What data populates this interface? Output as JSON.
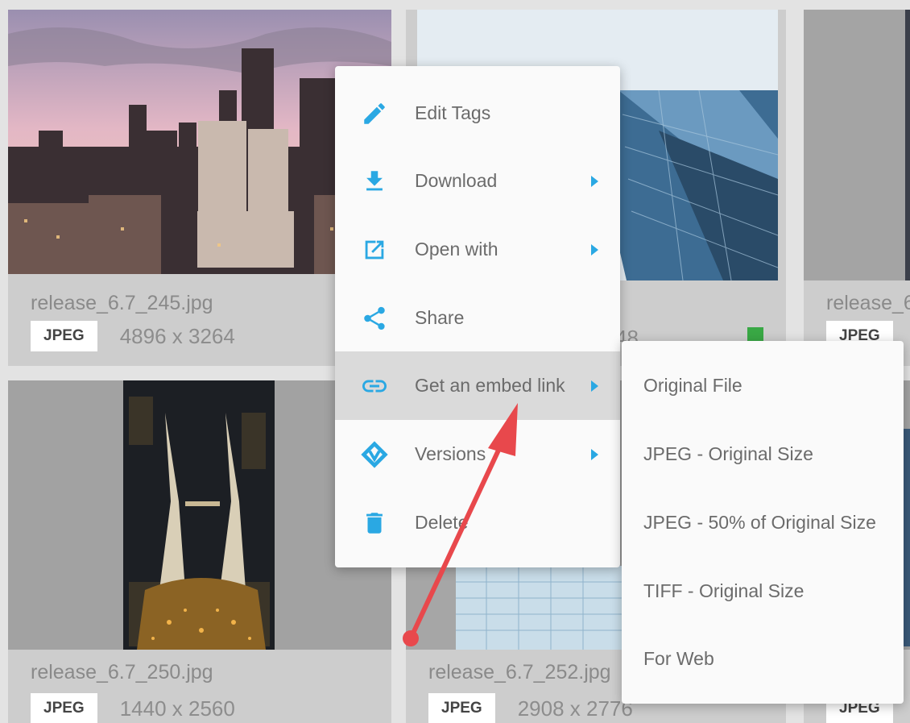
{
  "cards": [
    {
      "name": "release_6.7_245.jpg",
      "format": "JPEG",
      "dims": "4896 x 3264"
    },
    {
      "name": "",
      "format": "",
      "dims": "48"
    },
    {
      "name": "release_6",
      "format": "JPEG",
      "dims": ""
    },
    {
      "name": "release_6.7_250.jpg",
      "format": "JPEG",
      "dims": "1440 x 2560"
    },
    {
      "name": "release_6.7_252.jpg",
      "format": "JPEG",
      "dims": "2908 x 2776"
    },
    {
      "name": "",
      "format": "JPEG",
      "dims": ""
    }
  ],
  "context_menu": {
    "items": [
      {
        "label": "Edit Tags",
        "icon": "pencil-icon",
        "has_submenu": false
      },
      {
        "label": "Download",
        "icon": "download-icon",
        "has_submenu": true
      },
      {
        "label": "Open with",
        "icon": "open-external-icon",
        "has_submenu": true
      },
      {
        "label": "Share",
        "icon": "share-icon",
        "has_submenu": false
      },
      {
        "label": "Get an embed link",
        "icon": "link-icon",
        "has_submenu": true,
        "active": true
      },
      {
        "label": "Versions",
        "icon": "versions-icon",
        "has_submenu": true
      },
      {
        "label": "Delete",
        "icon": "trash-icon",
        "has_submenu": false
      }
    ]
  },
  "embed_submenu": {
    "items": [
      {
        "label": "Original File"
      },
      {
        "label": "JPEG - Original Size"
      },
      {
        "label": "JPEG - 50% of Original Size"
      },
      {
        "label": "TIFF - Original Size"
      },
      {
        "label": "For Web"
      }
    ]
  },
  "colors": {
    "accent": "#2aa8e3",
    "annotation_arrow": "#e8484c",
    "status_green": "#39a845"
  }
}
